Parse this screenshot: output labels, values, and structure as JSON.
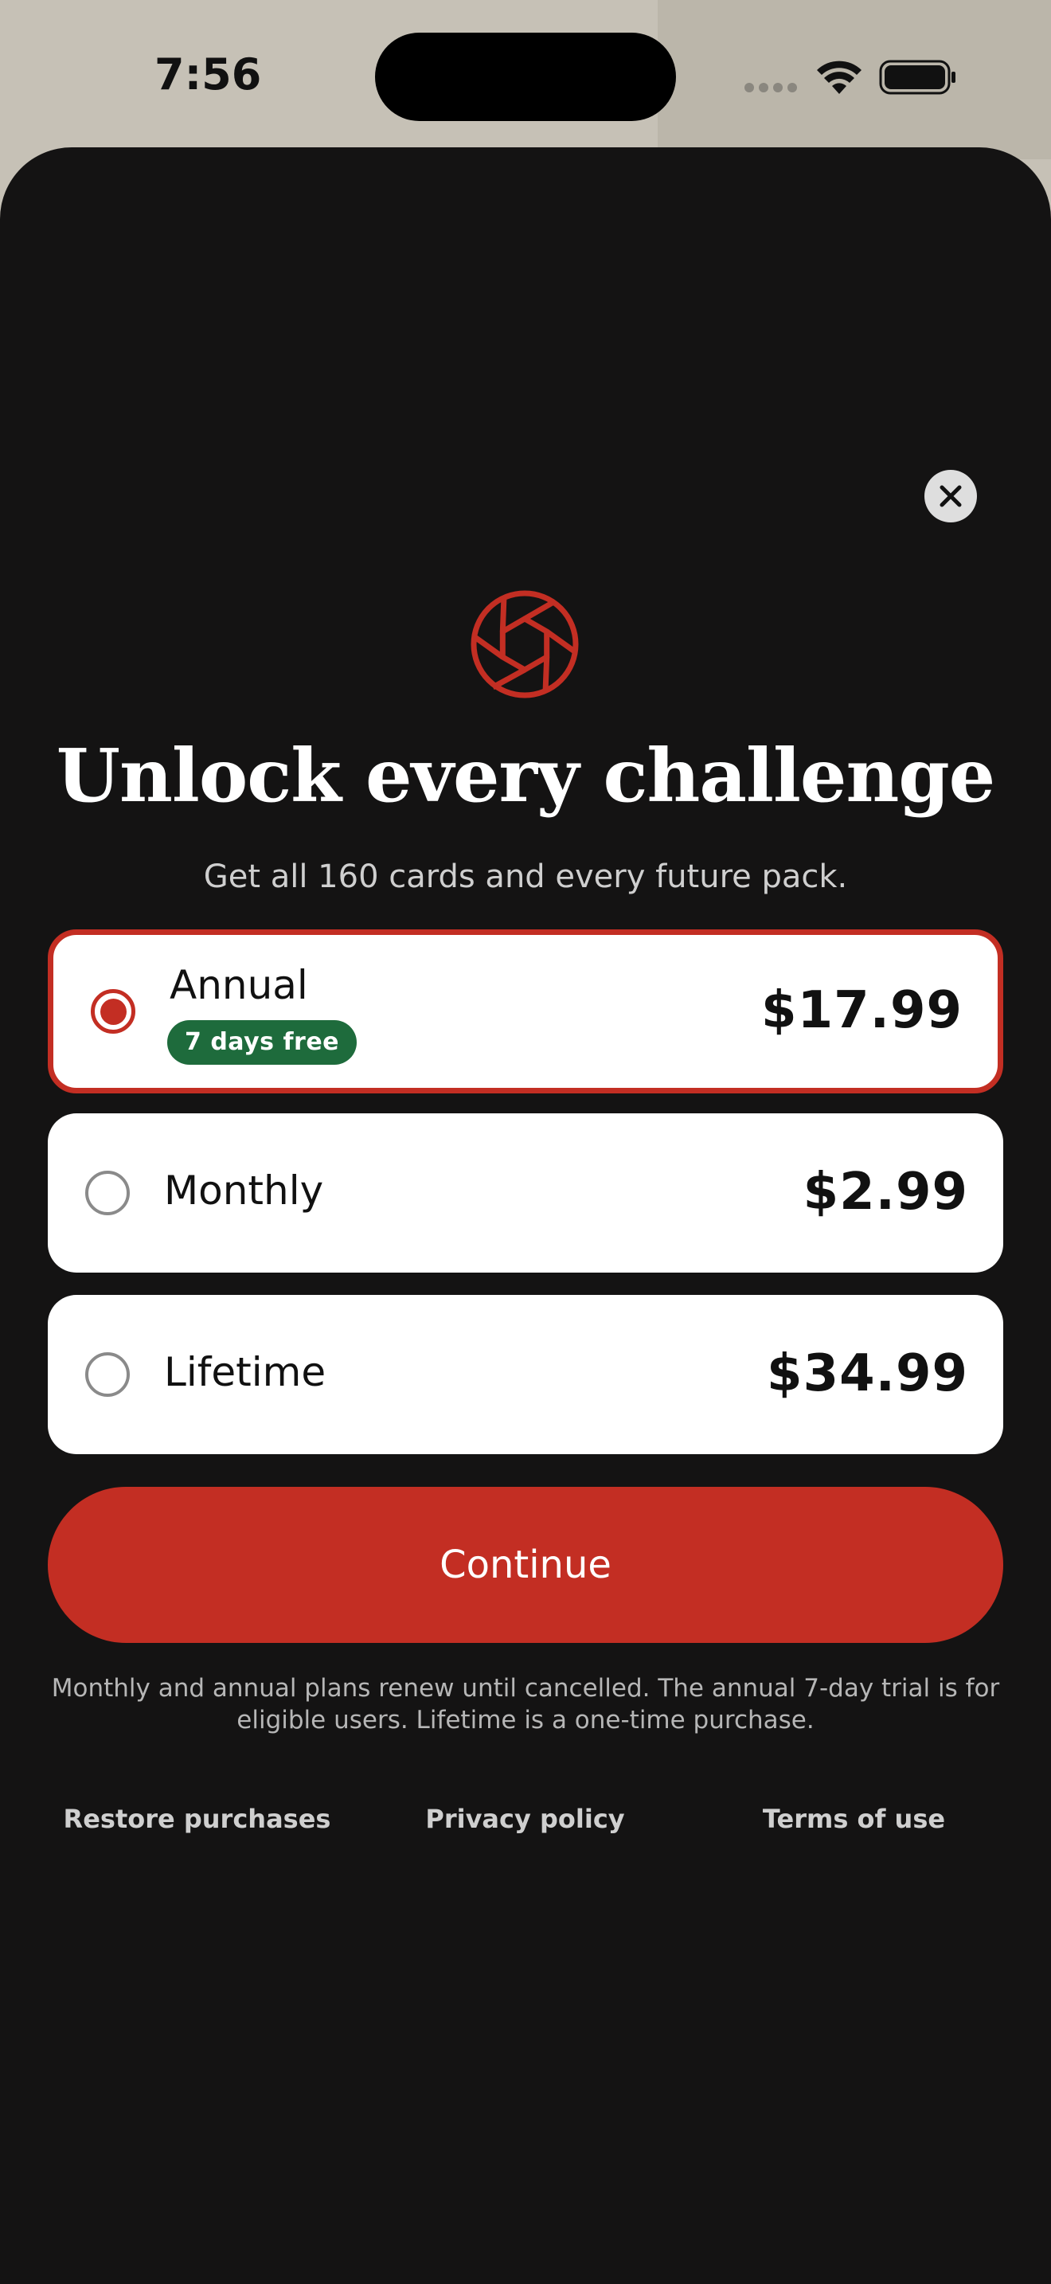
{
  "status_bar": {
    "time": "7:56"
  },
  "paywall": {
    "close_icon": "close-icon",
    "logo_icon": "aperture-icon",
    "headline": "Unlock every challenge",
    "subtitle": "Get all 160 cards and every future pack.",
    "plans": [
      {
        "name": "Annual",
        "price": "$17.99",
        "badge": "7 days free",
        "selected": true
      },
      {
        "name": "Monthly",
        "price": "$2.99",
        "selected": false
      },
      {
        "name": "Lifetime",
        "price": "$34.99",
        "selected": false
      }
    ],
    "continue_label": "Continue",
    "disclaimer": "Monthly and annual plans renew until cancelled. The annual 7-day trial is for eligible users. Lifetime is a one-time purchase.",
    "footer": {
      "restore": "Restore purchases",
      "privacy": "Privacy policy",
      "terms": "Terms of use"
    }
  },
  "colors": {
    "accent": "#c32e23",
    "badge_green": "#1e6b3c",
    "sheet_bg": "#141313",
    "backdrop": "#c6c1b6"
  }
}
